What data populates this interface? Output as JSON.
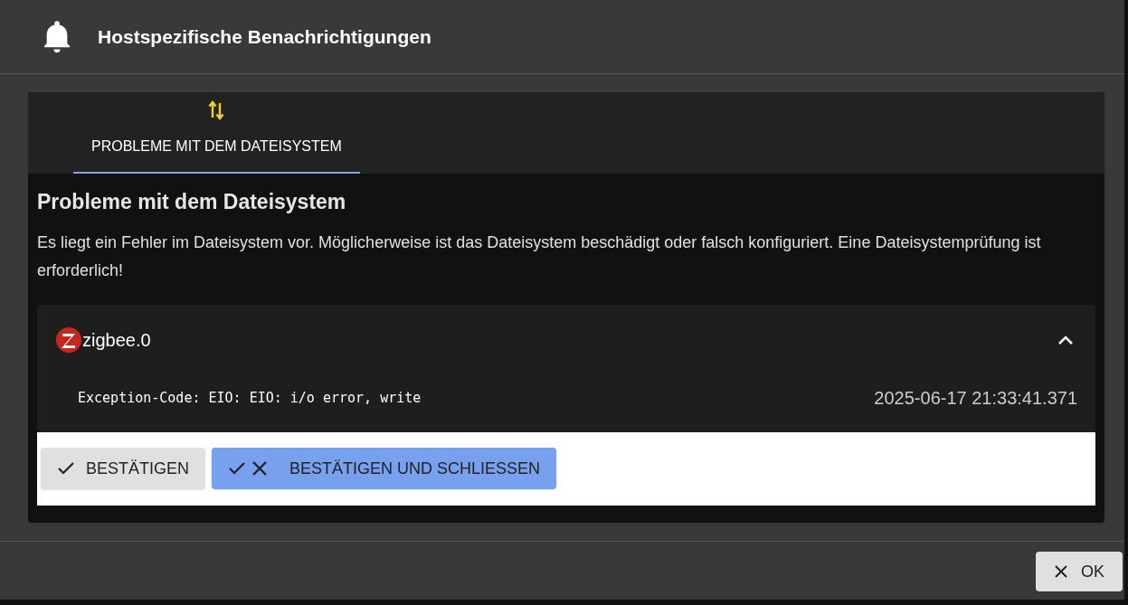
{
  "dialog": {
    "title": "Hostspezifische Benachrichtigungen"
  },
  "tabs": [
    {
      "label": "PROBLEME MIT DEM DATEISYSTEM",
      "selected": true
    }
  ],
  "section": {
    "heading": "Probleme mit dem Dateisystem",
    "description": "Es liegt ein Fehler im Dateisystem vor. Möglicherweise ist das Dateisystem beschädigt oder falsch konfiguriert. Eine Dateisystemprüfung ist erforderlich!"
  },
  "instances": [
    {
      "name": "zigbee.0",
      "expanded": true,
      "messages": [
        {
          "text": "Exception-Code: EIO: EIO: i/o error, write",
          "time": "2025-06-17 21:33:41.371"
        }
      ]
    }
  ],
  "actions": [
    {
      "kind": "confirm",
      "label": "BESTÄTIGEN"
    },
    {
      "kind": "confirm_close",
      "label": "BESTÄTIGEN UND SCHLIESSEN"
    }
  ],
  "footer": {
    "ok_label": "OK"
  }
}
